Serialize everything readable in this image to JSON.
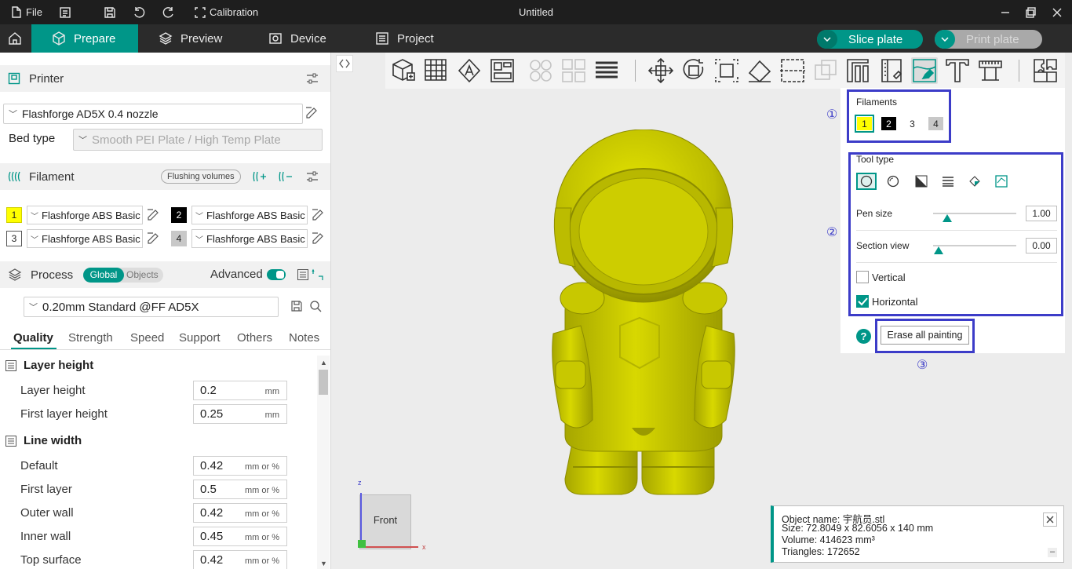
{
  "titlebar": {
    "file": "File",
    "calibration": "Calibration",
    "title": "Untitled"
  },
  "nav": {
    "prepare": "Prepare",
    "preview": "Preview",
    "device": "Device",
    "project": "Project",
    "slice": "Slice plate",
    "print": "Print plate"
  },
  "printer": {
    "header": "Printer",
    "name": "Flashforge AD5X 0.4 nozzle",
    "bed_label": "Bed type",
    "bed_value": "Smooth PEI Plate / High Temp Plate"
  },
  "filament": {
    "header": "Filament",
    "flushing": "Flushing volumes",
    "items": [
      {
        "num": "1",
        "name": "Flashforge ABS Basic",
        "color": "#ffff00"
      },
      {
        "num": "2",
        "name": "Flashforge ABS Basic",
        "color": "#000000"
      },
      {
        "num": "3",
        "name": "Flashforge ABS Basic",
        "color": "#ffffff"
      },
      {
        "num": "4",
        "name": "Flashforge ABS Basic",
        "color": "#c8c8c8"
      }
    ]
  },
  "process": {
    "header": "Process",
    "global": "Global",
    "objects": "Objects",
    "advanced": "Advanced",
    "preset": "0.20mm Standard @FF AD5X"
  },
  "tabs": [
    "Quality",
    "Strength",
    "Speed",
    "Support",
    "Others",
    "Notes"
  ],
  "quality": {
    "layer_group": "Layer height",
    "layer_rows": [
      {
        "label": "Layer height",
        "value": "0.2",
        "unit": "mm"
      },
      {
        "label": "First layer height",
        "value": "0.25",
        "unit": "mm"
      }
    ],
    "line_group": "Line width",
    "line_rows": [
      {
        "label": "Default",
        "value": "0.42",
        "unit": "mm or %"
      },
      {
        "label": "First layer",
        "value": "0.5",
        "unit": "mm or %"
      },
      {
        "label": "Outer wall",
        "value": "0.42",
        "unit": "mm or %"
      },
      {
        "label": "Inner wall",
        "value": "0.45",
        "unit": "mm or %"
      },
      {
        "label": "Top surface",
        "value": "0.42",
        "unit": "mm or %"
      }
    ]
  },
  "paint": {
    "filaments_label": "Filaments",
    "f1": "1",
    "f2": "2",
    "f3": "3",
    "f4": "4",
    "tool_type": "Tool type",
    "pen_size": "Pen size",
    "pen_value": "1.00",
    "section_view": "Section view",
    "section_value": "0.00",
    "vertical": "Vertical",
    "horizontal": "Horizontal",
    "erase": "Erase all painting",
    "c1": "①",
    "c2": "②",
    "c3": "③",
    "help": "?"
  },
  "viewcube": {
    "front": "Front",
    "z": "z",
    "x": "x"
  },
  "info": {
    "name": "Object name: 宇航员.stl",
    "size": "Size: 72.8049 x 82.6056 x 140 mm",
    "volume": "Volume: 414623 mm³",
    "triangles": "Triangles: 172652"
  },
  "colors": {
    "accent": "#009688",
    "highlight": "#3c3cc8",
    "model": "#c8c800"
  }
}
